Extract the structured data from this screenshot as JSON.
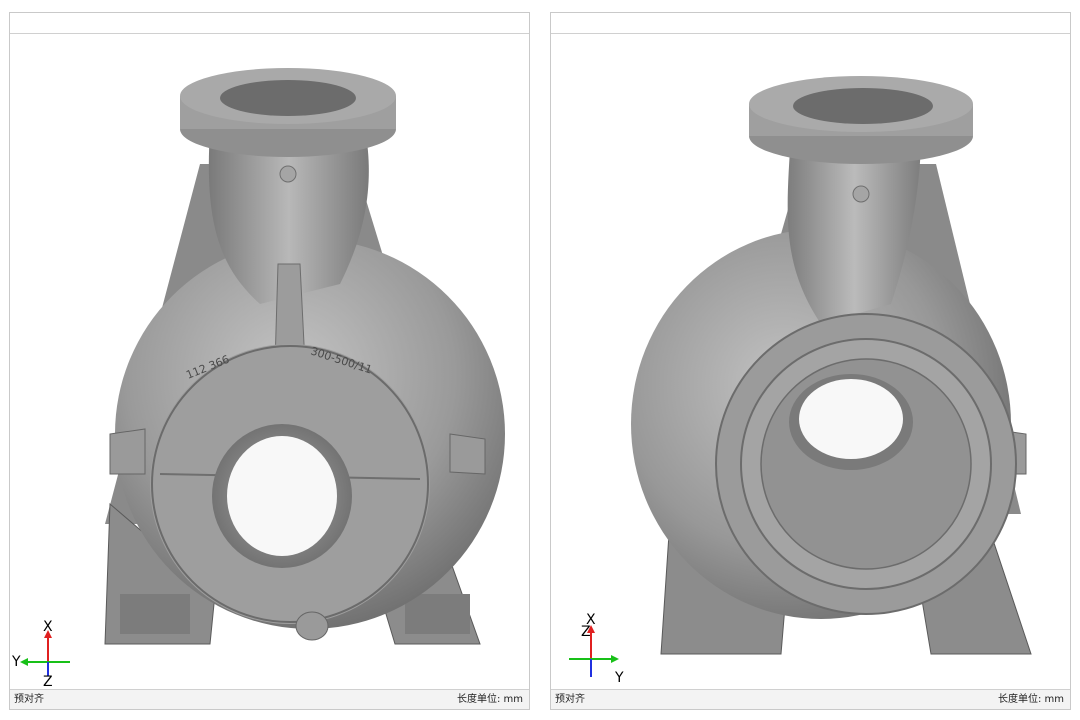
{
  "viewports": [
    {
      "status_left": "预对齐",
      "unit_label": "长度单位:",
      "unit_value": "mm",
      "triad": {
        "x": "X",
        "y": "Y",
        "z": "Z"
      },
      "casting_text": {
        "part_no": "112 366",
        "model": "300-500/11"
      }
    },
    {
      "status_left": "预对齐",
      "unit_label": "长度单位:",
      "unit_value": "mm",
      "triad": {
        "x": "X",
        "y": "Y",
        "z": "Z"
      }
    }
  ],
  "colors": {
    "model_light": "#bdbdbd",
    "model_mid": "#8e8e8e",
    "model_dark": "#5e5e5e",
    "axis_x": "#e02020",
    "axis_y": "#18c018",
    "axis_z": "#2030e0"
  }
}
